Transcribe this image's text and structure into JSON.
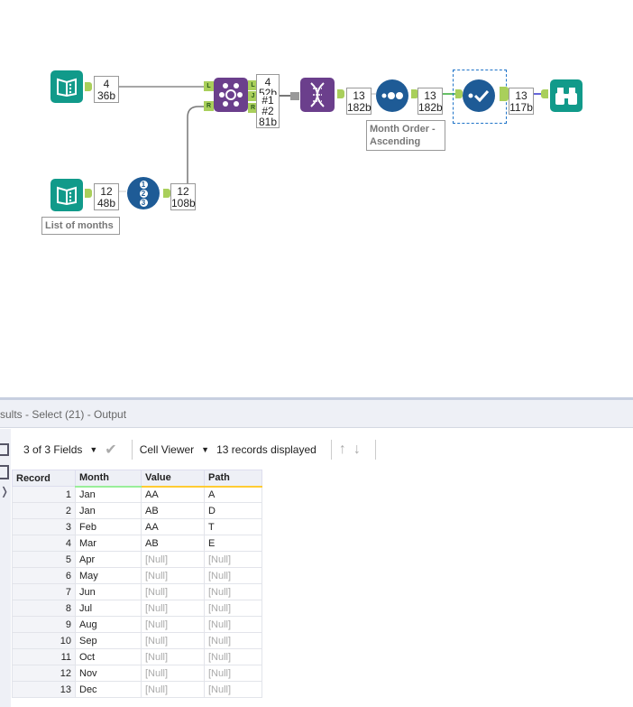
{
  "workflow": {
    "input1": {
      "count": "4",
      "size": "36b"
    },
    "join_out": {
      "l_count": "4",
      "l_size": "52b",
      "j1": "#1",
      "j2": "#2",
      "r_size": "81b"
    },
    "join_ports": [
      "L",
      "R",
      "L",
      "J",
      "R"
    ],
    "dna_out": {
      "count": "13",
      "size": "182b"
    },
    "sort_out": {
      "count": "13",
      "size": "182b"
    },
    "sort_annotation": "Month Order - Ascending",
    "select_out": {
      "count": "13",
      "size": "117b"
    },
    "input2": {
      "count": "12",
      "size": "48b",
      "annotation": "List of months"
    },
    "recordid_out": {
      "count": "12",
      "size": "108b"
    },
    "recordid_digits": [
      "1",
      "2",
      "3"
    ]
  },
  "results": {
    "title": "sults - Select (21) - Output",
    "fields": "3 of 3 Fields",
    "viewer": "Cell Viewer",
    "records": "13 records displayed",
    "columns": [
      "Record",
      "Month",
      "Value",
      "Path"
    ],
    "rows": [
      [
        "1",
        "Jan",
        "AA",
        "A"
      ],
      [
        "2",
        "Jan",
        "AB",
        "D"
      ],
      [
        "3",
        "Feb",
        "AA",
        "T"
      ],
      [
        "4",
        "Mar",
        "AB",
        "E"
      ],
      [
        "5",
        "Apr",
        "[Null]",
        "[Null]"
      ],
      [
        "6",
        "May",
        "[Null]",
        "[Null]"
      ],
      [
        "7",
        "Jun",
        "[Null]",
        "[Null]"
      ],
      [
        "8",
        "Jul",
        "[Null]",
        "[Null]"
      ],
      [
        "9",
        "Aug",
        "[Null]",
        "[Null]"
      ],
      [
        "10",
        "Sep",
        "[Null]",
        "[Null]"
      ],
      [
        "11",
        "Oct",
        "[Null]",
        "[Null]"
      ],
      [
        "12",
        "Nov",
        "[Null]",
        "[Null]"
      ],
      [
        "13",
        "Dec",
        "[Null]",
        "[Null]"
      ]
    ]
  }
}
